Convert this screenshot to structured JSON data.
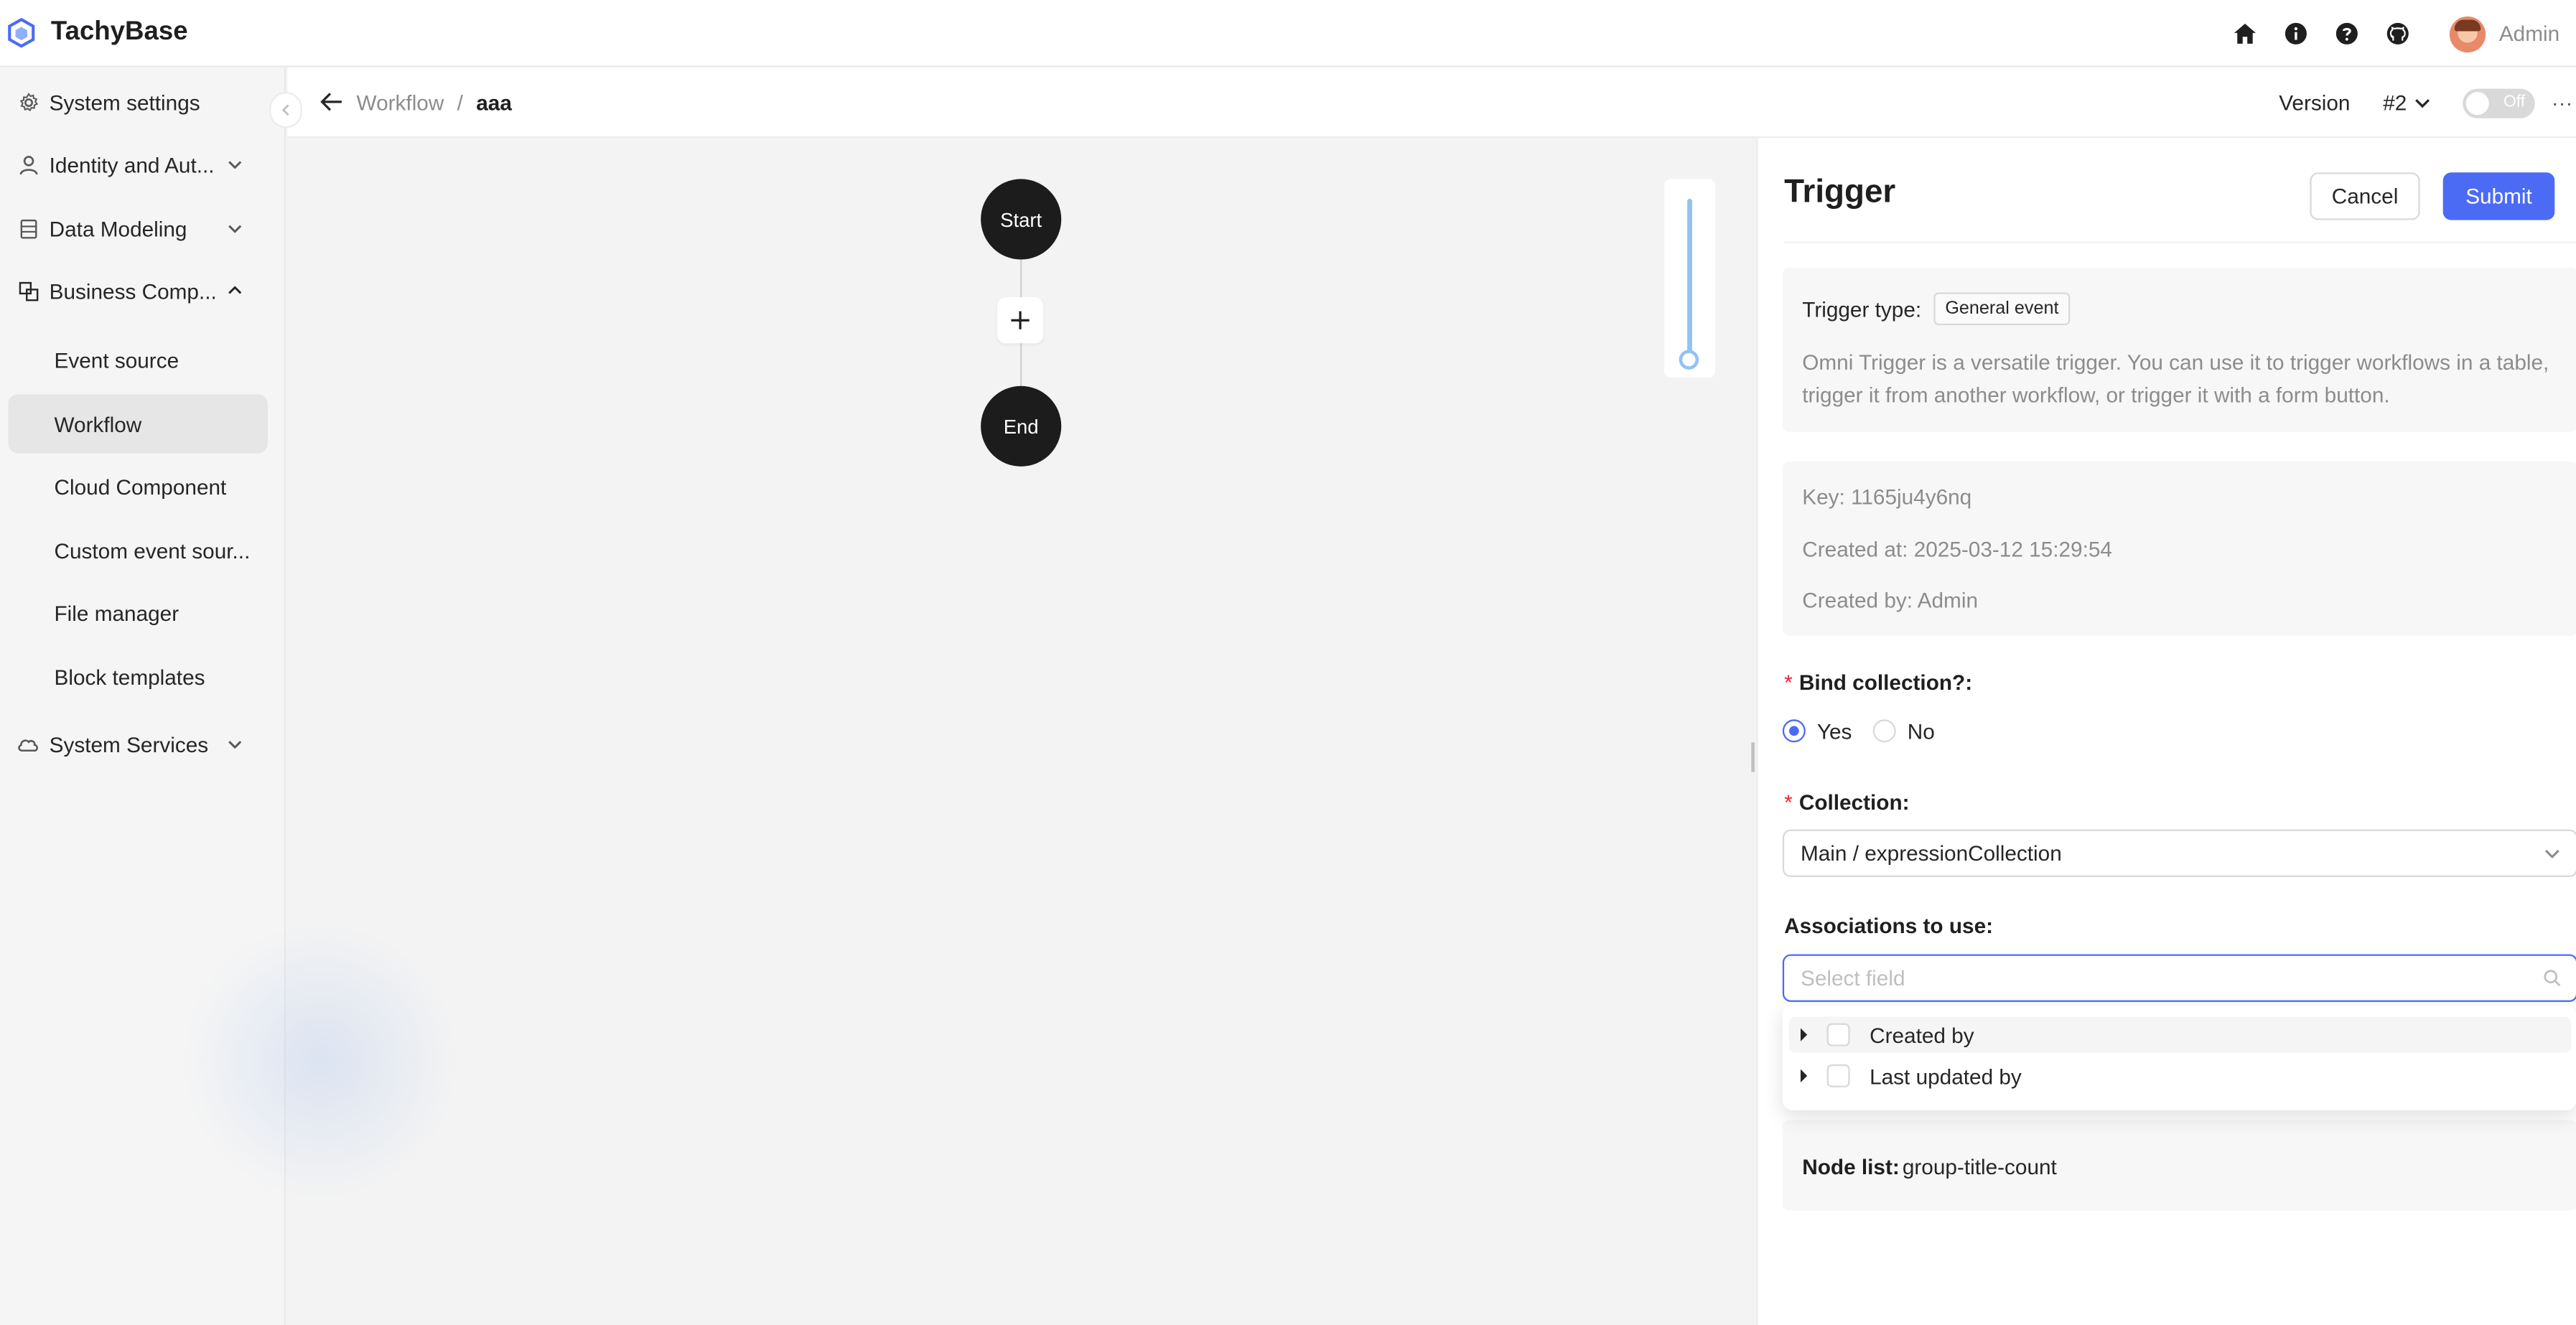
{
  "app": {
    "name": "TachyBase"
  },
  "header": {
    "user_name": "Admin"
  },
  "sidebar": {
    "items": [
      {
        "label": "System settings"
      },
      {
        "label": "Identity and Aut..."
      },
      {
        "label": "Data Modeling"
      },
      {
        "label": "Business Comp..."
      },
      {
        "label": "System Services"
      }
    ],
    "sub_items": [
      {
        "label": "Event source"
      },
      {
        "label": "Workflow"
      },
      {
        "label": "Cloud Component"
      },
      {
        "label": "Custom event sour..."
      },
      {
        "label": "File manager"
      },
      {
        "label": "Block templates"
      }
    ]
  },
  "breadcrumb": {
    "parent": "Workflow",
    "separator": "/",
    "current": "aaa"
  },
  "version": {
    "label": "Version",
    "value": "#2",
    "toggle_label": "Off",
    "more": "···"
  },
  "canvas": {
    "start_label": "Start",
    "end_label": "End",
    "zoom_level": 0.0
  },
  "drawer": {
    "title": "Trigger",
    "cancel_label": "Cancel",
    "submit_label": "Submit",
    "trigger_type_label": "Trigger type:",
    "trigger_type_value": "General event",
    "trigger_description": "Omni Trigger is a versatile trigger. You can use it to trigger workflows in a table, trigger it from another workflow, or trigger it with a form button.",
    "key_line": "Key: 1165ju4y6nq",
    "created_at_line": "Created at: 2025-03-12 15:29:54",
    "created_by_line": "Created by: Admin",
    "bind_collection_label": "Bind collection?",
    "bind_yes": "Yes",
    "bind_no": "No",
    "bind_selected": "Yes",
    "collection_label": "Collection",
    "collection_value": "Main / expressionCollection",
    "associations_label": "Associations to use",
    "associations_placeholder": "Select field",
    "association_options": [
      {
        "label": "Created by"
      },
      {
        "label": "Last updated by"
      }
    ],
    "node_list_label": "Node list:",
    "node_list_value": "group-title-count"
  },
  "colors": {
    "primary": "#4b6bf5",
    "node": "#1c1c1c",
    "required": "#f5222d"
  }
}
